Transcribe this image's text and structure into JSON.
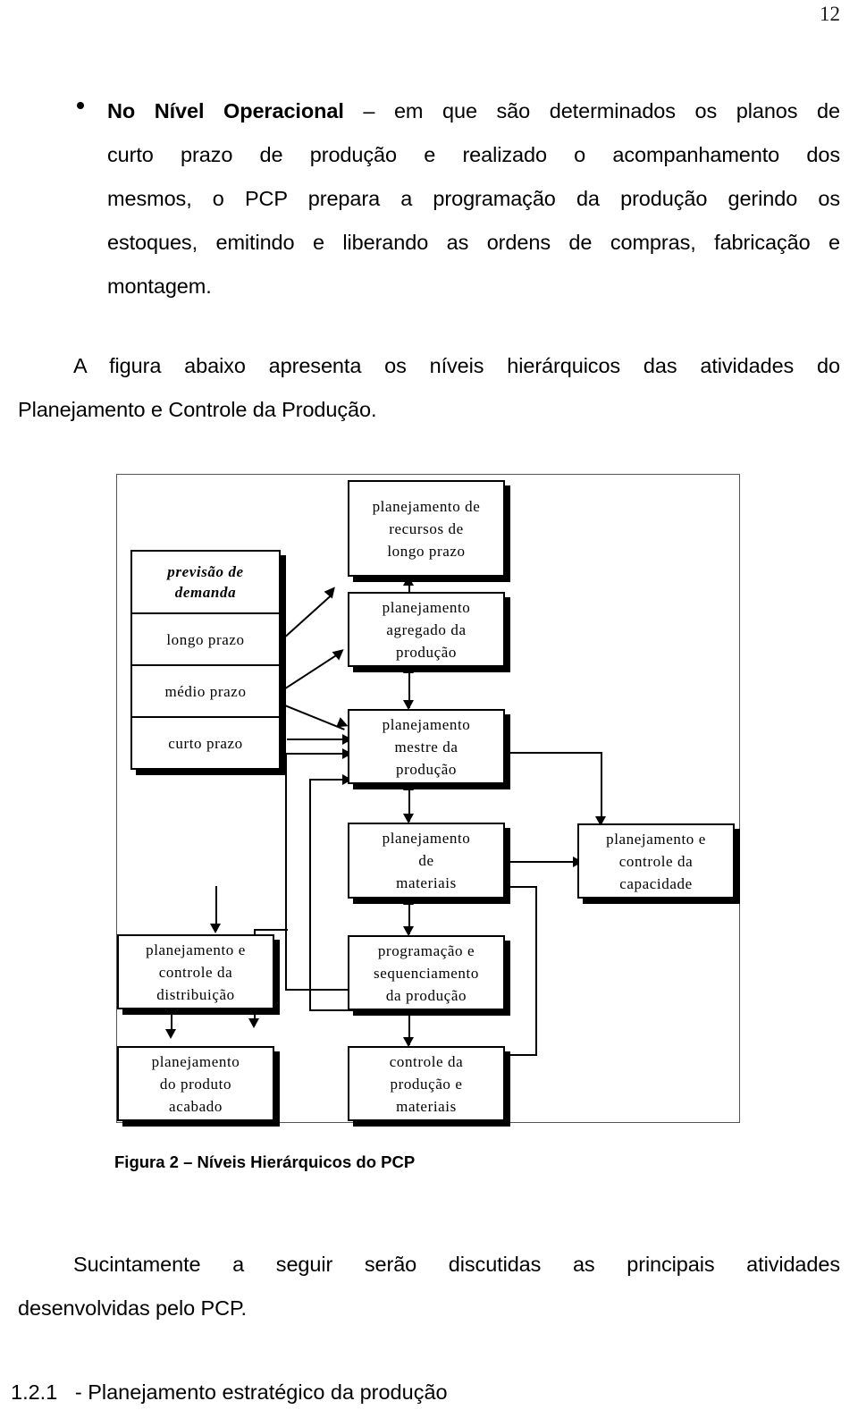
{
  "page": {
    "number": "12"
  },
  "body": {
    "bullet_paragraph": {
      "lead_bold": "No Nível Operacional",
      "line1_rest": " – em que são determinados os planos de",
      "line2": "curto prazo de produção e realizado o acompanhamento dos",
      "line3": "mesmos, o PCP prepara a programação da produção gerindo os",
      "line4": "estoques, emitindo e liberando as ordens de compras, fabricação e",
      "line5": "montagem."
    },
    "intro_paragraph": {
      "line1": "A figura abaixo apresenta os níveis hierárquicos das atividades do",
      "line2": "Planejamento e Controle da Produção."
    },
    "figure_caption": "Figura 2 – Níveis Hierárquicos do PCP",
    "closing_paragraph": {
      "line1": "Sucintamente a seguir serão discutidas as principais atividades",
      "line2": "desenvolvidas pelo PCP."
    },
    "section_heading": "1.2.1   - Planejamento estratégico da produção"
  },
  "figure": {
    "boxes": {
      "previsao": {
        "header": {
          "l1": "previsão de",
          "l2": "demanda"
        },
        "rows": [
          "longo prazo",
          "médio prazo",
          "curto  prazo"
        ]
      },
      "recursos_longo_prazo": {
        "l1": "planejamento de",
        "l2": "recursos de",
        "l3": "longo prazo"
      },
      "agregado": {
        "l1": "planejamento",
        "l2": "agregado da",
        "l3": "produção"
      },
      "mestre": {
        "l1": "planejamento",
        "l2": "mestre da",
        "l3": "produção"
      },
      "materiais": {
        "l1": "planejamento",
        "l2": "de",
        "l3": "materiais"
      },
      "capacidade": {
        "l1": "planejamento e",
        "l2": "controle da",
        "l3": "capacidade"
      },
      "distribuicao": {
        "l1": "planejamento e",
        "l2": "controle da",
        "l3": "distribuição"
      },
      "sequenciamento": {
        "l1": "programação e",
        "l2": "sequenciamento",
        "l3": "da produção"
      },
      "produto_acabado": {
        "l1": "planejamento",
        "l2": "do produto",
        "l3": "acabado"
      },
      "controle_producao": {
        "l1": "controle da",
        "l2": "produção e",
        "l3": "materiais"
      }
    }
  }
}
